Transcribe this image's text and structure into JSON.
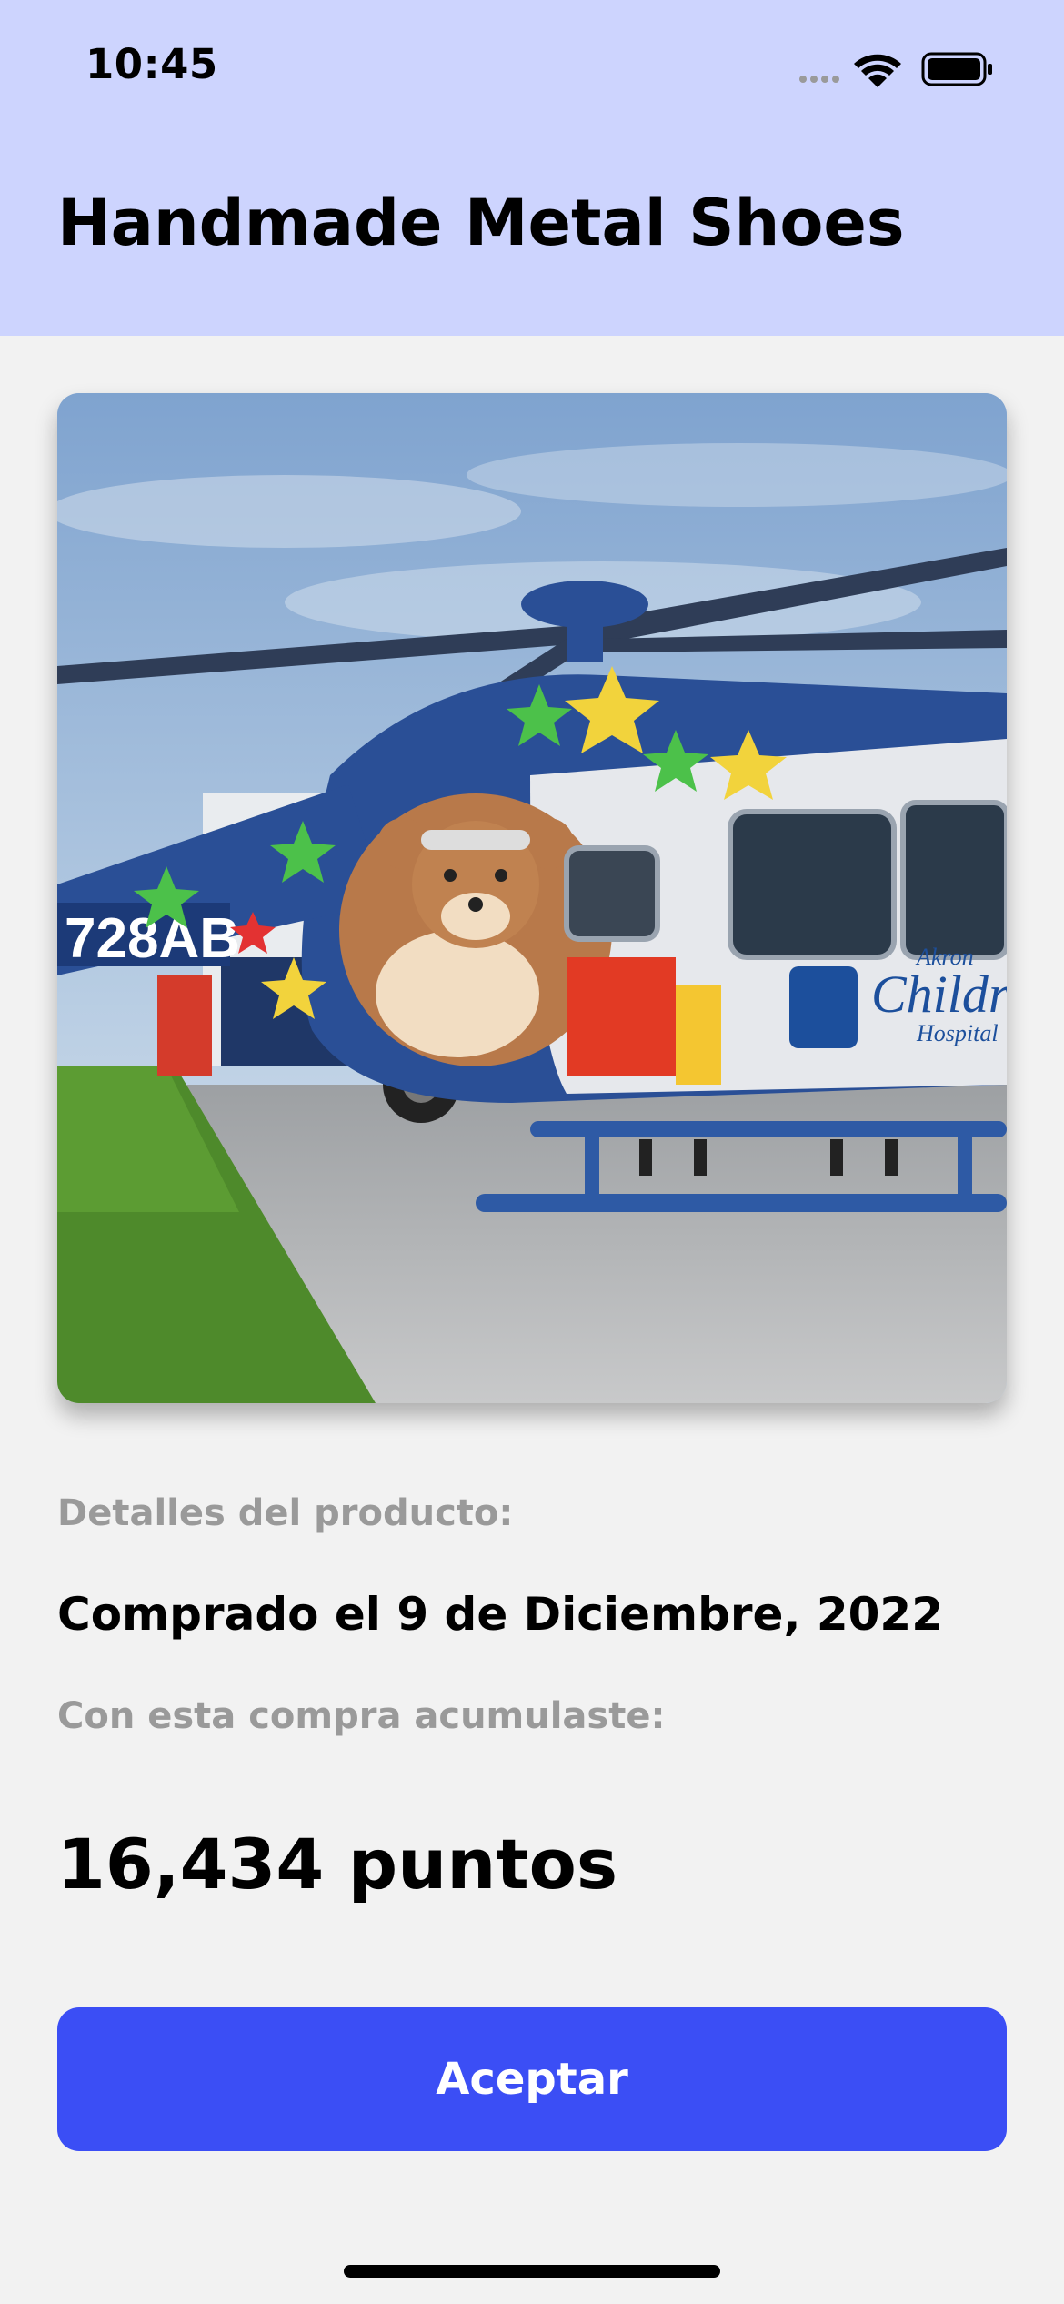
{
  "status_bar": {
    "time": "10:45",
    "icons": [
      "cellular-signal-icon",
      "wifi-icon",
      "battery-icon"
    ]
  },
  "header": {
    "title": "Handmade Metal Shoes",
    "background": "#cdd4fe"
  },
  "product": {
    "image_icon": "helicopter-photo",
    "details_label": "Detalles del producto:",
    "purchase_date": "Comprado el 9 de Diciembre, 2022",
    "accumulated_label": "Con esta compra acumulaste:",
    "points": "16,434 puntos"
  },
  "actions": {
    "accept_label": "Aceptar",
    "accent_color": "#3b4ef5"
  }
}
